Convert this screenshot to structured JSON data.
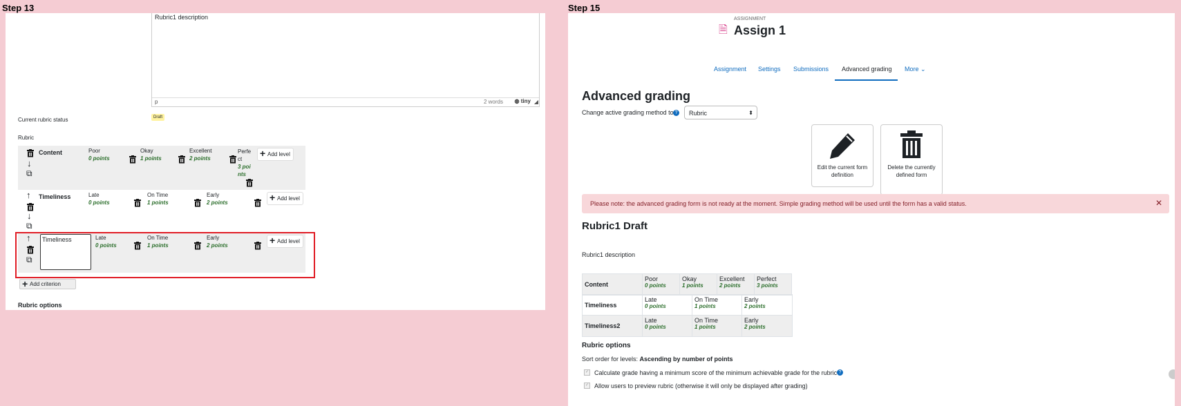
{
  "left": {
    "step_title": "Step 13",
    "editor": {
      "text": "Rubric1 description",
      "footer_tag": "p",
      "word_count": "2 words",
      "brand": "tiny"
    },
    "status_label": "Current rubric status",
    "status_badge": "Draft",
    "rubric_label": "Rubric",
    "criteria": [
      {
        "name": "Content",
        "levels": [
          {
            "label": "Poor",
            "points": "0 points"
          },
          {
            "label": "Okay",
            "points": "1 points"
          },
          {
            "label": "Excellent",
            "points": "2 points"
          },
          {
            "label": "Perfect",
            "points": "3 points"
          }
        ]
      },
      {
        "name": "Timeliness",
        "levels": [
          {
            "label": "Late",
            "points": "0 points"
          },
          {
            "label": "On Time",
            "points": "1 points"
          },
          {
            "label": "Early",
            "points": "2 points"
          }
        ]
      },
      {
        "name": "Timeliness",
        "levels": [
          {
            "label": "Late",
            "points": "0 points"
          },
          {
            "label": "On Time",
            "points": "1 points"
          },
          {
            "label": "Early",
            "points": "2 points"
          }
        ]
      }
    ],
    "add_level": "Add level",
    "add_criterion": "Add criterion",
    "options_label": "Rubric options",
    "highlight_color": "#e01b24"
  },
  "right": {
    "step_title": "Step 15",
    "pretitle": "ASSIGNMENT",
    "title": "Assign 1",
    "tabs": [
      "Assignment",
      "Settings",
      "Submissions",
      "Advanced grading",
      "More"
    ],
    "active_tab": "Advanced grading",
    "heading": "Advanced grading",
    "method_label": "Change active grading method to",
    "method_value": "Rubric",
    "card_edit": "Edit the current form definition",
    "card_delete": "Delete the currently defined form",
    "alert": "Please note: the advanced grading form is not ready at the moment. Simple grading method will be used until the form has a valid status.",
    "rubric_title": "Rubric1 Draft",
    "rubric_desc": "Rubric1 description",
    "table": [
      {
        "name": "Content",
        "levels": [
          {
            "label": "Poor",
            "points": "0 points"
          },
          {
            "label": "Okay",
            "points": "1 points"
          },
          {
            "label": "Excellent",
            "points": "2 points"
          },
          {
            "label": "Perfect",
            "points": "3 points"
          }
        ]
      },
      {
        "name": "Timeliness",
        "levels": [
          {
            "label": "Late",
            "points": "0 points"
          },
          {
            "label": "On Time",
            "points": "1 points"
          },
          {
            "label": "Early",
            "points": "2 points"
          }
        ]
      },
      {
        "name": "Timeliness2",
        "levels": [
          {
            "label": "Late",
            "points": "0 points"
          },
          {
            "label": "On Time",
            "points": "1 points"
          },
          {
            "label": "Early",
            "points": "2 points"
          }
        ]
      }
    ],
    "options_heading": "Rubric options",
    "sort_label": "Sort order for levels:",
    "sort_value": "Ascending by number of points",
    "check1": "Calculate grade having a minimum score of the minimum achievable grade for the rubric",
    "check2": "Allow users to preview rubric (otherwise it will only be displayed after grading)",
    "alert_bg": "#f8d7da",
    "alert_text_color": "#842029",
    "link_color": "#0f6cbf"
  }
}
